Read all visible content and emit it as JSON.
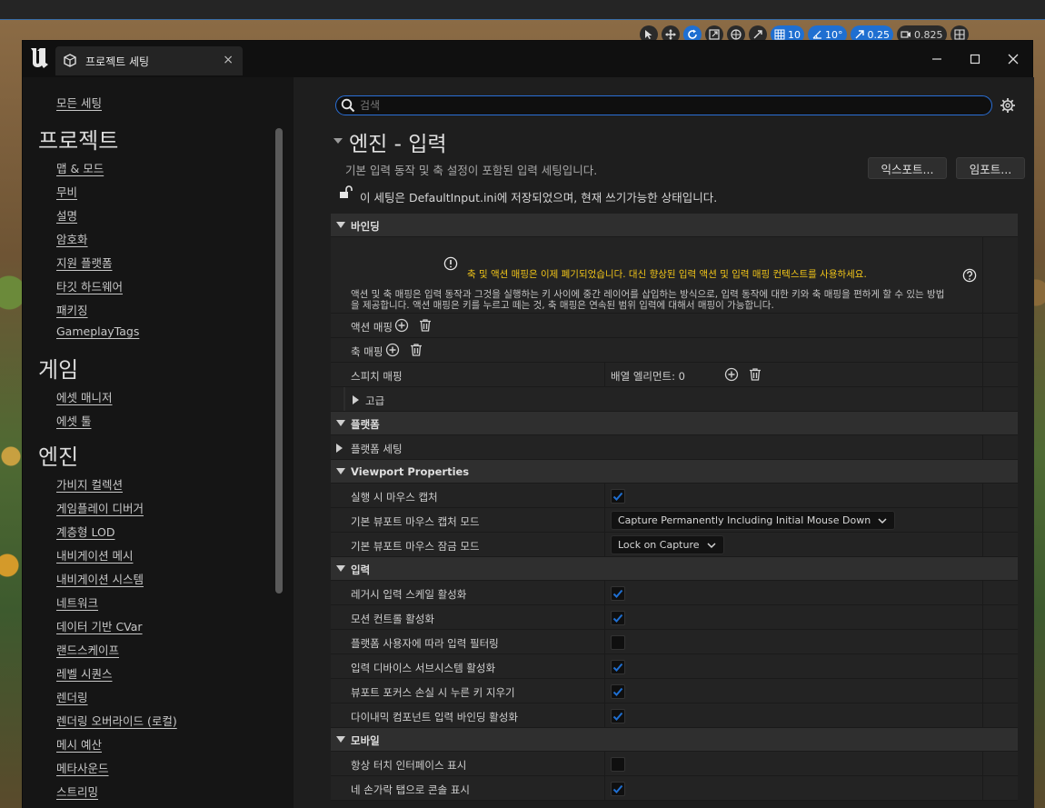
{
  "viewport_toolbar": {
    "grid_snap": "10",
    "rotation_snap": "10°",
    "scale_snap": "0.25",
    "camera_speed": "0.825"
  },
  "window": {
    "tab_title": "프로젝트 세팅",
    "tab_close": "×"
  },
  "sidebar": {
    "all_settings": "모든 세팅",
    "sections": [
      {
        "heading": "프로젝트",
        "items": [
          "맵 & 모드",
          "무비",
          "설명",
          "암호화",
          "지원 플랫폼",
          "타깃 하드웨어",
          "패키징",
          "GameplayTags"
        ]
      },
      {
        "heading": "게임",
        "items": [
          "에셋 매니저",
          "에셋 툴"
        ]
      },
      {
        "heading": "엔진",
        "items": [
          "가비지 컬렉션",
          "게임플레이 디버거",
          "계층형 LOD",
          "내비게이션 메시",
          "내비게이션 시스템",
          "네트워크",
          "데이터 기반 CVar",
          "랜드스케이프",
          "레벨 시퀀스",
          "렌더링",
          "렌더링 오버라이드 (로컬)",
          "메시 예산",
          "메타사운드",
          "스트리밍"
        ]
      }
    ]
  },
  "main": {
    "search_placeholder": "검색",
    "title": "엔진 - 입력",
    "description": "기본 입력 동작 및 축 설정이 포함된 입력 세팅입니다.",
    "export_label": "익스포트...",
    "import_label": "임포트...",
    "lock_message": "이 세팅은 DefaultInput.ini에 저장되었으며, 현재 쓰기가능한 상태입니다."
  },
  "bindings": {
    "category": "바인딩",
    "warning": "축 및 액션 매핑은 이제 폐기되었습니다. 대신 향상된 입력 액션 및 입력 매핑 컨텍스트를 사용하세요.",
    "description": "액션 및 축 매핑은 입력 동작과 그것을 실행하는 키 사이에 중간 레이어를 삽입하는 방식으로, 입력 동작에 대한 키와 축 매핑을 편하게 할 수 있는 방법을 제공합니다. 액션 매핑은 키를 누르고 떼는 것, 축 매핑은 연속된 범위 입력에 대해서 매핑이 가능합니다.",
    "action_mappings": "액션 매핑",
    "axis_mappings": "축 매핑",
    "speech_mappings": "스피치 매핑",
    "array_elements": "배열 엘리먼트: 0",
    "advanced": "고급"
  },
  "platform": {
    "category": "플랫폼",
    "settings": "플랫폼 세팅"
  },
  "viewport_properties": {
    "category": "Viewport Properties",
    "capture_on_launch": {
      "label": "실행 시 마우스 캡처",
      "checked": true
    },
    "default_capture_mode": {
      "label": "기본 뷰포트 마우스 캡처 모드",
      "value": "Capture Permanently Including Initial Mouse Down"
    },
    "default_lock_mode": {
      "label": "기본 뷰포트 마우스 잠금 모드",
      "value": "Lock on Capture"
    }
  },
  "input": {
    "category": "입력",
    "rows": [
      {
        "label": "레거시 입력 스케일 활성화",
        "checked": true
      },
      {
        "label": "모션 컨트롤 활성화",
        "checked": true
      },
      {
        "label": "플랫폼 사용자에 따라 입력 필터링",
        "checked": false
      },
      {
        "label": "입력 디바이스 서브시스템 활성화",
        "checked": true
      },
      {
        "label": "뷰포트 포커스 손실 시 누른 키 지우기",
        "checked": true
      },
      {
        "label": "다이내믹 컴포넌트 입력 바인딩 활성화",
        "checked": true
      }
    ]
  },
  "mobile": {
    "category": "모바일",
    "rows": [
      {
        "label": "항상 터치 인터페이스 표시",
        "checked": false
      },
      {
        "label": "네 손가락 탭으로 콘솔 표시",
        "checked": true
      }
    ]
  },
  "colors": {
    "accent": "#1f6fd1",
    "warning": "#f0c419"
  }
}
